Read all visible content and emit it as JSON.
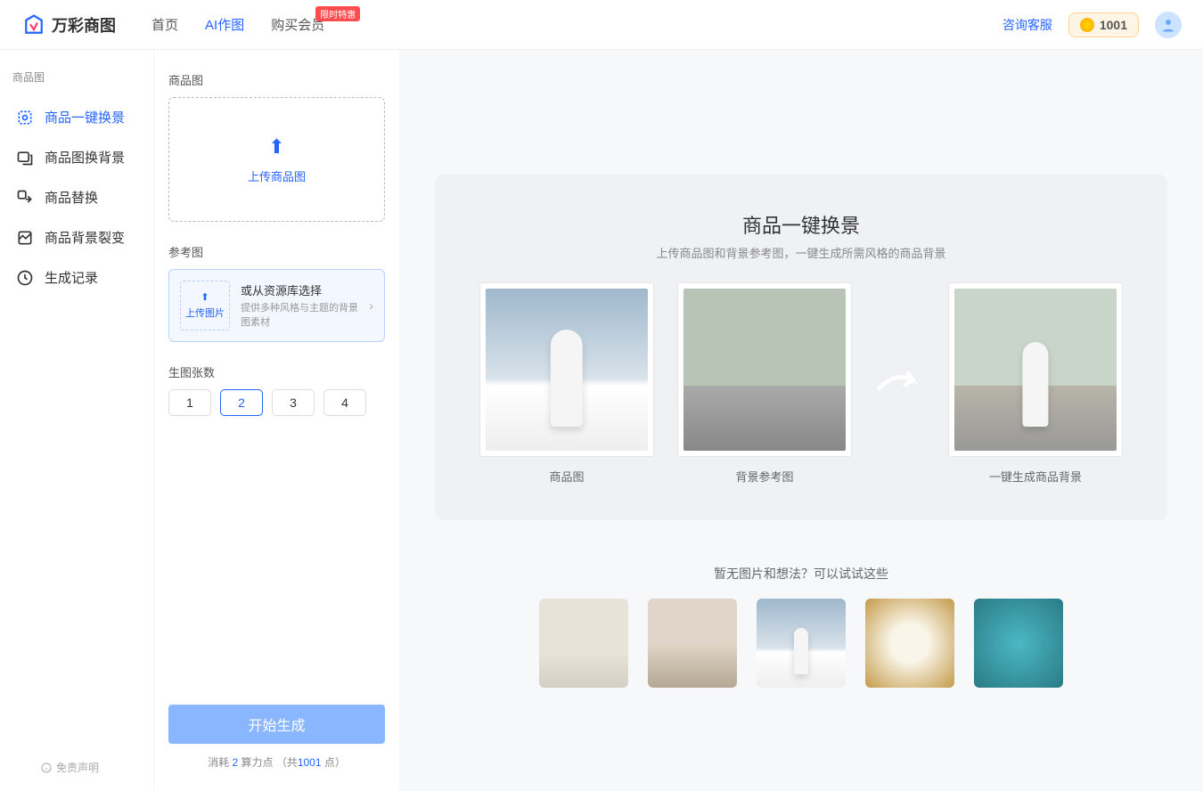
{
  "header": {
    "logo_text": "万彩商图",
    "nav": [
      "首页",
      "AI作图",
      "购买会员"
    ],
    "badge": "限时特惠",
    "support": "咨询客服",
    "points": "1001"
  },
  "sidebar": {
    "section": "商品图",
    "items": [
      "商品一键换景",
      "商品图换背景",
      "商品替换",
      "商品背景裂变",
      "生成记录"
    ],
    "disclaimer": "免责声明"
  },
  "panel": {
    "product_label": "商品图",
    "upload_text": "上传商品图",
    "ref_label": "参考图",
    "ref_upload": "上传图片",
    "ref_title": "或从资源库选择",
    "ref_desc": "提供多种风格与主题的背景图素材",
    "count_label": "生图张数",
    "counts": [
      "1",
      "2",
      "3",
      "4"
    ],
    "start": "开始生成",
    "cost_pre": "消耗 ",
    "cost_num": "2",
    "cost_mid": " 算力点  （共",
    "cost_total": "1001",
    "cost_end": " 点）"
  },
  "main": {
    "hero_title": "商品一键换景",
    "hero_sub": "上传商品图和背景参考图，一键生成所需风格的商品背景",
    "cap1": "商品图",
    "cap2": "背景参考图",
    "cap3": "一键生成商品背景",
    "prompt": "暂无图片和想法？可以试试这些"
  }
}
